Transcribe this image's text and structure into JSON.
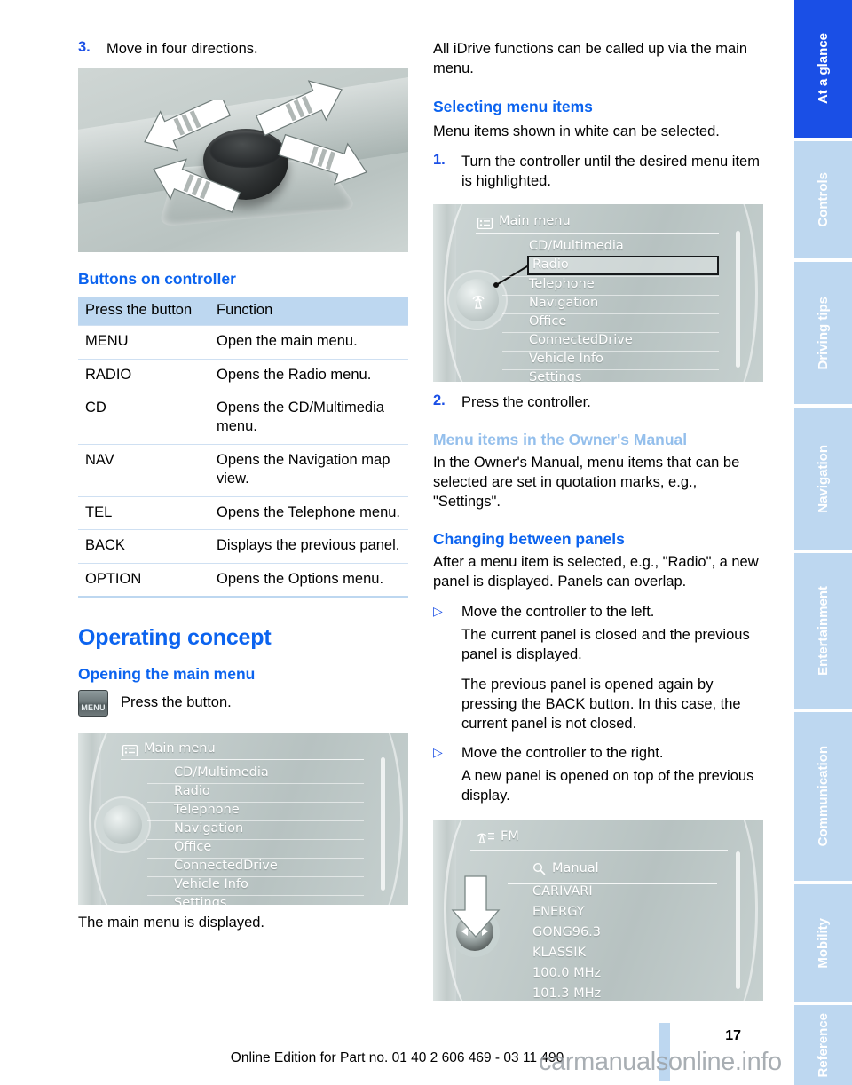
{
  "page": {
    "number": "17",
    "footer": "Online Edition for Part no. 01 40 2 606 469 - 03 11 490",
    "watermark": "carmanualsonline.info"
  },
  "sidebar": {
    "tabs": [
      {
        "label": "At a glance",
        "active": true
      },
      {
        "label": "Controls",
        "active": false
      },
      {
        "label": "Driving tips",
        "active": false
      },
      {
        "label": "Navigation",
        "active": false
      },
      {
        "label": "Entertainment",
        "active": false
      },
      {
        "label": "Communication",
        "active": false
      },
      {
        "label": "Mobility",
        "active": false
      },
      {
        "label": "Reference",
        "active": false
      }
    ]
  },
  "left": {
    "step3": {
      "num": "3.",
      "text": "Move in four directions."
    },
    "photo_caption": "iDrive controller with four directional arrows",
    "heading_buttons": "Buttons on controller",
    "table": {
      "headers": [
        "Press the button",
        "Function"
      ],
      "rows": [
        [
          "MENU",
          "Open the main menu."
        ],
        [
          "RADIO",
          "Opens the Radio menu."
        ],
        [
          "CD",
          "Opens the CD/Multimedia menu."
        ],
        [
          "NAV",
          "Opens the Navigation map view."
        ],
        [
          "TEL",
          "Opens the Telephone menu."
        ],
        [
          "BACK",
          "Displays the previous panel."
        ],
        [
          "OPTION",
          "Opens the Options menu."
        ]
      ]
    },
    "heading_operating": "Operating concept",
    "heading_opening": "Opening the main menu",
    "menu_key_label": "MENU",
    "press_button": "Press the button.",
    "main_menu_caption": "The main menu is displayed."
  },
  "right": {
    "intro": "All iDrive functions can be called up via the main menu.",
    "heading_selecting": "Selecting menu items",
    "selecting_body": "Menu items shown in white can be selected.",
    "step1": {
      "num": "1.",
      "text": "Turn the controller until the desired menu item is highlighted."
    },
    "step2": {
      "num": "2.",
      "text": "Press the controller."
    },
    "heading_owners": "Menu items in the Owner's Manual",
    "owners_body": "In the Owner's Manual, menu items that can be selected are set in quotation marks, e.g., \"Settings\".",
    "heading_changing": "Changing between panels",
    "changing_body": "After a menu item is selected, e.g., \"Radio\", a new panel is displayed. Panels can overlap.",
    "bullets": [
      {
        "marker": "▷",
        "text": "Move the controller to the left.",
        "notes": [
          "The current panel is closed and the previous panel is displayed.",
          "The previous panel is opened again by pressing the BACK button. In this case, the current panel is not closed."
        ]
      },
      {
        "marker": "▷",
        "text": "Move the controller to the right.",
        "notes": [
          "A new panel is opened on top of the previous display."
        ]
      }
    ]
  },
  "idrive_main_menu": {
    "title": "Main menu",
    "title_icon": "list-menu-icon",
    "items": [
      "CD/Multimedia",
      "Radio",
      "Telephone",
      "Navigation",
      "Office",
      "ConnectedDrive",
      "Vehicle Info",
      "Settings"
    ],
    "highlighted": null
  },
  "idrive_main_menu_selected": {
    "title": "Main menu",
    "title_icon": "list-menu-icon",
    "items": [
      "CD/Multimedia",
      "Radio",
      "Telephone",
      "Navigation",
      "Office",
      "ConnectedDrive",
      "Vehicle Info",
      "Settings"
    ],
    "highlighted": "Radio"
  },
  "idrive_fm": {
    "title": "FM",
    "title_icon": "radio-antenna-icon",
    "search_icon": "magnifier-icon",
    "search_label": "Manual",
    "items": [
      "CARIVARI",
      "ENERGY",
      "GONG96.3",
      "KLASSIK",
      "100.0  MHz",
      "101.3  MHz"
    ]
  },
  "colors": {
    "heading_blue": "#0b63ef",
    "heading_blue_faded": "#94bfec",
    "tab_active": "#1a4fe6",
    "tab_inactive": "#bdd7f0",
    "table_header": "#bdd7f0",
    "table_rule": "#cfe0f2"
  }
}
